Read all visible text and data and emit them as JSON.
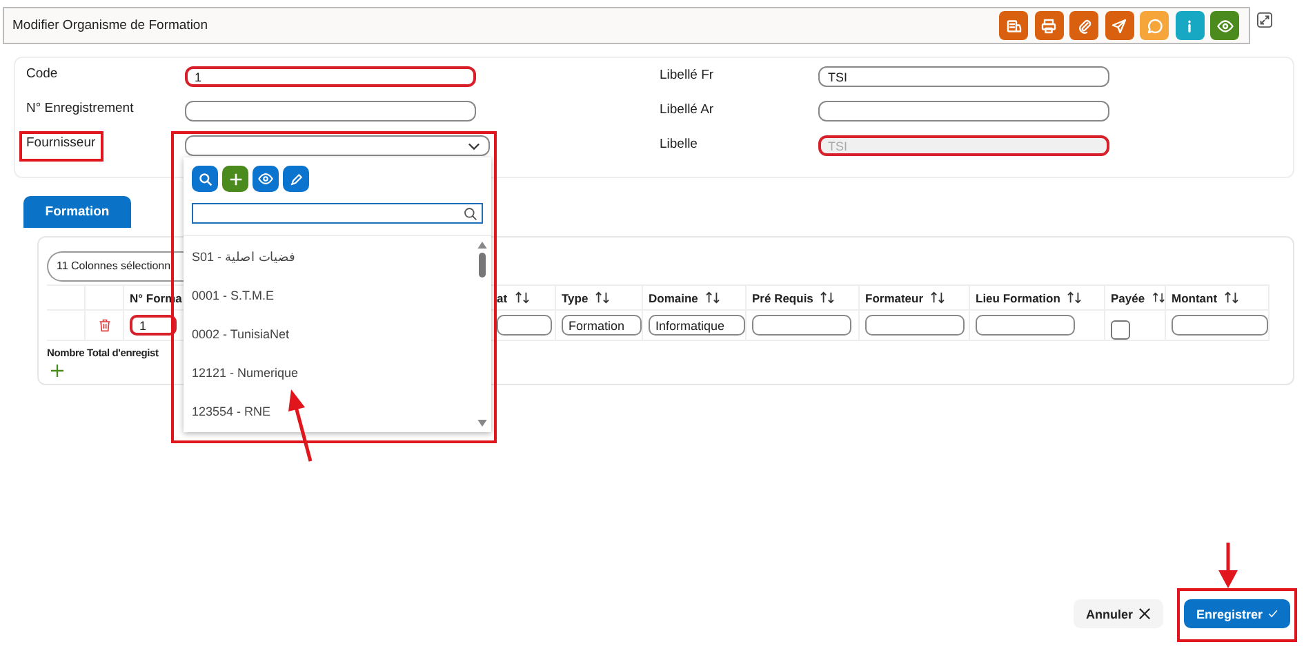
{
  "window": {
    "title": "Modifier Organisme de Formation"
  },
  "toolbar": [
    {
      "kind": "document",
      "color": "#d8600e"
    },
    {
      "kind": "print",
      "color": "#d8600e"
    },
    {
      "kind": "attach",
      "color": "#d8600e"
    },
    {
      "kind": "send",
      "color": "#d8600e"
    },
    {
      "kind": "chat",
      "color": "#f6a53a"
    },
    {
      "kind": "info",
      "color": "#17a9c4"
    },
    {
      "kind": "eye",
      "color": "#4b8a1c"
    }
  ],
  "form": {
    "left": [
      {
        "kind": "text",
        "label": "Code",
        "value": "1",
        "label_highlighted": false,
        "field_highlighted": true
      },
      {
        "kind": "text",
        "label": "N° Enregistrement",
        "label_highlighted": false,
        "field_highlighted": false
      },
      {
        "kind": "select",
        "label": "Fournisseur",
        "label_highlighted": true,
        "field_highlighted": false
      }
    ],
    "right": [
      {
        "label": "Libellé Fr",
        "value": "TSI",
        "disabled": false,
        "field_highlighted": false
      },
      {
        "label": "Libellé Ar",
        "disabled": false,
        "field_highlighted": false
      },
      {
        "label": "Libelle",
        "value": "TSI",
        "disabled": true,
        "field_highlighted": true
      }
    ]
  },
  "dropdown": {
    "expanded": true,
    "highlighted": true,
    "options": [
      "S01 - فضيات اصلية",
      "0001 - S.T.M.E",
      "0002 - TunisiaNet",
      "12121 - Numerique",
      "123554 - RNE"
    ]
  },
  "tabs": [
    {
      "label": "Formation",
      "selected": true
    }
  ],
  "table": {
    "column_selector": "11 Colonnes sélectionn",
    "columns": [
      "N° Forma",
      "at",
      "Type",
      "Domaine",
      "Pré Requis",
      "Formateur",
      "Lieu Formation",
      "Payée",
      "Montant"
    ],
    "rows": [
      {
        "cells": [
          {
            "kind": "field",
            "value": "1",
            "highlighted": true
          },
          {
            "kind": "field",
            "highlighted": false
          },
          {
            "kind": "field",
            "value": "Formation",
            "highlighted": false
          },
          {
            "kind": "field",
            "value": "Informatique",
            "highlighted": false
          },
          {
            "kind": "field",
            "highlighted": false
          },
          {
            "kind": "field",
            "highlighted": false
          },
          {
            "kind": "field",
            "highlighted": false
          },
          {
            "kind": "checkbox",
            "checked": false
          },
          {
            "kind": "field",
            "highlighted": false
          }
        ]
      }
    ],
    "total_label": "Nombre Total d'enregist"
  },
  "buttons": [
    {
      "kind": "cancel",
      "label": "Annuler",
      "highlighted": false
    },
    {
      "kind": "save",
      "label": "Enregistrer",
      "highlighted": true
    }
  ]
}
